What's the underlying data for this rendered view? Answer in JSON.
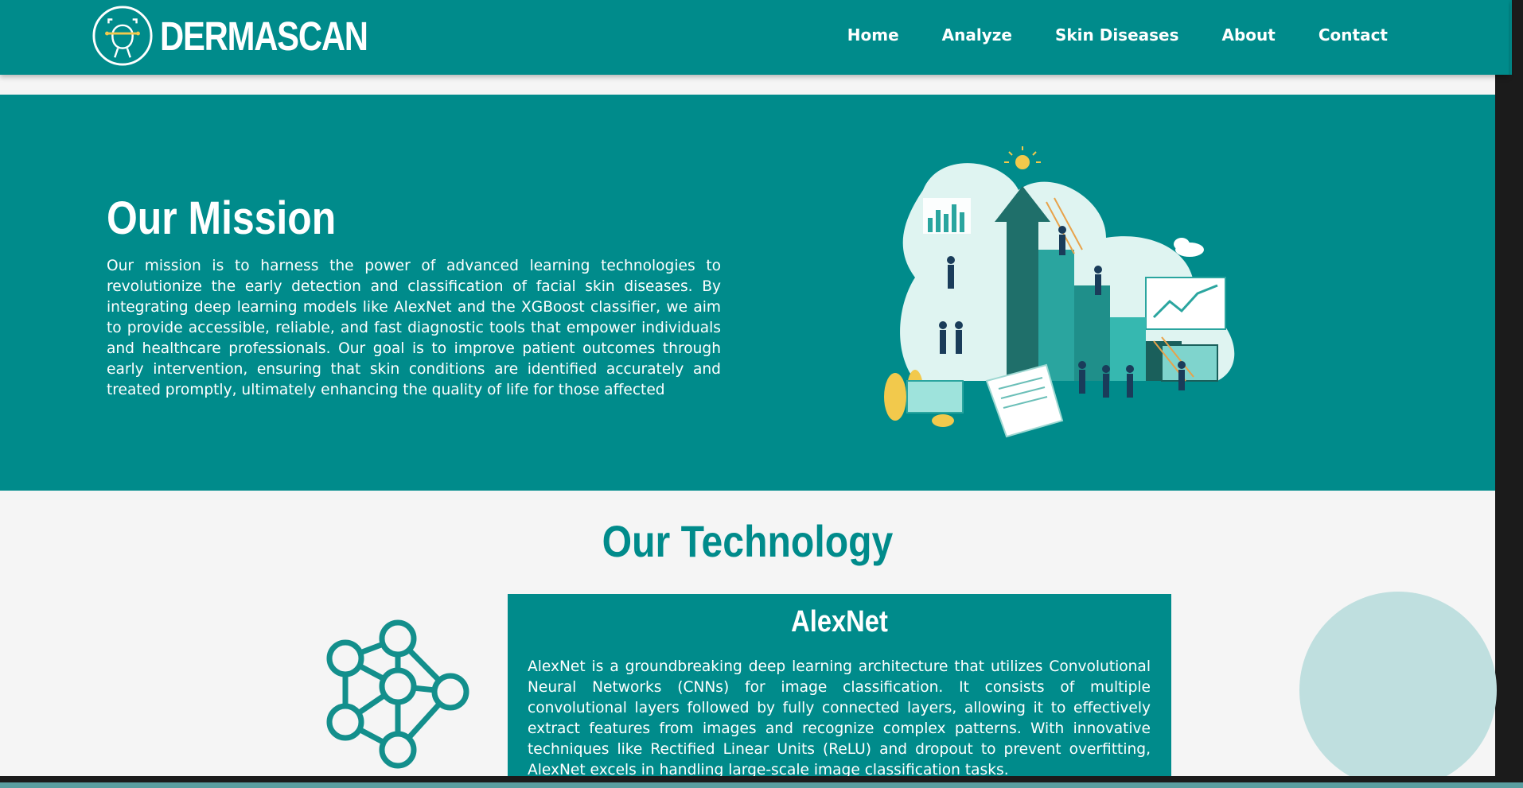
{
  "header": {
    "brand": "DERMASCAN",
    "nav": [
      "Home",
      "Analyze",
      "Skin Diseases",
      "About",
      "Contact"
    ]
  },
  "mission": {
    "title": "Our Mission",
    "text": "Our mission is to harness the power of advanced learning technologies to revolutionize the early detection and classification of facial skin diseases. By integrating deep learning models like AlexNet and the XGBoost classifier, we aim to provide accessible, reliable, and fast diagnostic tools that empower individuals and healthcare professionals. Our goal is to improve patient outcomes through early intervention, ensuring that skin conditions are identified accurately and treated promptly, ultimately enhancing the quality of life for those affected"
  },
  "technology": {
    "title": "Our Technology",
    "card": {
      "title": "AlexNet",
      "text": "AlexNet is a groundbreaking deep learning architecture that utilizes Convolutional Neural Networks (CNNs) for image classification. It consists of multiple convolutional layers followed by fully connected layers, allowing it to effectively extract features from images and recognize complex patterns. With innovative techniques like Rectified Linear Units (ReLU) and dropout to prevent overfitting, AlexNet excels in handling large-scale image classification tasks."
    }
  },
  "icons": {
    "logo": "face-scan-icon",
    "technology": "neural-network-icon"
  },
  "colors": {
    "primary": "#008b8b",
    "background": "#f5f5f5",
    "accent_light": "#bfdfdf"
  }
}
